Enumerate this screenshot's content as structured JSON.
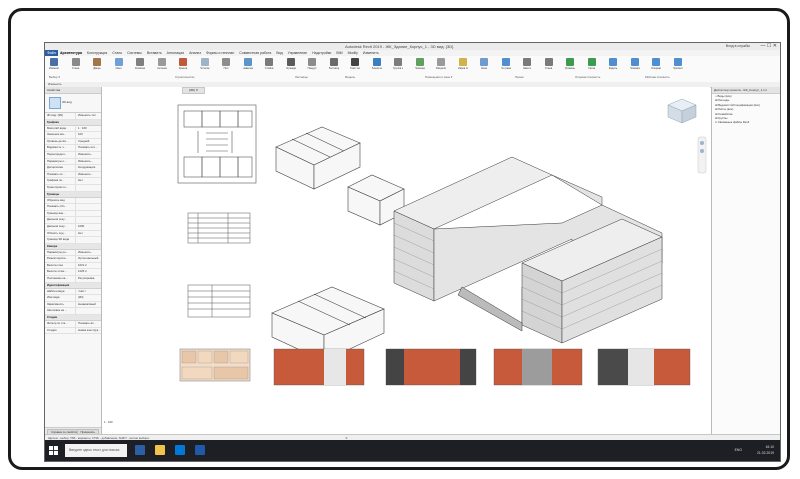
{
  "window": {
    "title": "Autodesk Revit 2019 - ЖК_Здание_Корпус_1 - 3D вид: {3D}",
    "search_hint": "Введите ключевое слово или фразу",
    "user": "Вход в службы",
    "controls": "—  ☐  ✕"
  },
  "menu": {
    "file": "Файл",
    "tabs": [
      "Архитектура",
      "Конструкция",
      "Сталь",
      "Системы",
      "Вставить",
      "Аннотации",
      "Анализ",
      "Формы и генплан",
      "Совместная работа",
      "Вид",
      "Управление",
      "Надстройки",
      "BIM",
      "Modify",
      "Изменить"
    ]
  },
  "ribbon": {
    "buttons": [
      {
        "label": "Изменить",
        "icon": "modify-arrow-icon",
        "color": "#4a6fa8"
      },
      {
        "label": "Стена",
        "icon": "wall-icon",
        "color": "#8a8a8a"
      },
      {
        "label": "Дверь",
        "icon": "door-icon",
        "color": "#a0764a"
      },
      {
        "label": "Окно",
        "icon": "window-icon",
        "color": "#6ea2d6"
      },
      {
        "label": "Компонент",
        "icon": "component-icon",
        "color": "#7f7f7f"
      },
      {
        "label": "Колонна",
        "icon": "column-icon",
        "color": "#9a9a9a"
      },
      {
        "label": "Крыша",
        "icon": "roof-icon",
        "color": "#c05a3c"
      },
      {
        "label": "Потолок",
        "icon": "ceiling-icon",
        "color": "#9fb4c8"
      },
      {
        "label": "Пол",
        "icon": "floor-icon",
        "color": "#8d8d8d"
      },
      {
        "label": "Навесная стена",
        "icon": "curtain-wall-icon",
        "color": "#5d95c8"
      },
      {
        "label": "Стойка",
        "icon": "mullion-icon",
        "color": "#7a7a7a"
      },
      {
        "label": "Ограждение",
        "icon": "railing-icon",
        "color": "#5b5b5b"
      },
      {
        "label": "Пандус",
        "icon": "ramp-icon",
        "color": "#8c8c8c"
      },
      {
        "label": "Лестница",
        "icon": "stair-icon",
        "color": "#6c6c6c"
      },
      {
        "label": "Текст модели",
        "icon": "model-text-icon",
        "color": "#444444"
      },
      {
        "label": "Линия модели",
        "icon": "model-line-icon",
        "color": "#3b7fbf"
      },
      {
        "label": "Группа модели",
        "icon": "model-group-icon",
        "color": "#7d7d7d"
      },
      {
        "label": "Помещение",
        "icon": "room-icon",
        "color": "#5fa05f"
      },
      {
        "label": "Разделитель",
        "icon": "separator-icon",
        "color": "#9a9a9a"
      },
      {
        "label": "Марка помещения",
        "icon": "room-tag-icon",
        "color": "#d2b348"
      },
      {
        "label": "Зона",
        "icon": "area-icon",
        "color": "#6f9bd0"
      },
      {
        "label": "По грани",
        "icon": "by-face-icon",
        "color": "#4f8fcf"
      },
      {
        "label": "Шахта",
        "icon": "shaft-icon",
        "color": "#7a7a7a"
      },
      {
        "label": "Стена",
        "icon": "opening-wall-icon",
        "color": "#7a7a7a"
      },
      {
        "label": "Уровень",
        "icon": "level-icon",
        "color": "#3c9b4f"
      },
      {
        "label": "Сетка",
        "icon": "grid-icon",
        "color": "#3c9b4f"
      },
      {
        "label": "Задать",
        "icon": "set-workplane-icon",
        "color": "#4f8fcf"
      },
      {
        "label": "Показать",
        "icon": "show-icon",
        "color": "#4f8fcf"
      },
      {
        "label": "Опорная плоскость",
        "icon": "ref-plane-icon",
        "color": "#4f8fcf"
      },
      {
        "label": "Просмотр",
        "icon": "viewer-icon",
        "color": "#4f8fcf"
      }
    ],
    "groups": [
      "Выбор ▾",
      "Строительство",
      "Лестницы",
      "Модель",
      "Помещения и зоны ▾",
      "Проем",
      "Опорная плоскость",
      "Рабочая плоскость"
    ]
  },
  "options_bar": "Изменить",
  "properties": {
    "title": "Свойства",
    "type_name": "3D вид",
    "selector": "3D вид: {3D}",
    "edit_type": "Изменить тип",
    "sections": [
      {
        "name": "Графика",
        "rows": [
          [
            "Масштаб вида",
            "1 : 100"
          ],
          [
            "Значение ма...",
            "100"
          ],
          [
            "Уровень детал...",
            "Средний"
          ],
          [
            "Видимость ч...",
            "Показать исх..."
          ],
          [
            "Переопредел...",
            "Изменить..."
          ],
          [
            "Параметры о...",
            "Изменить..."
          ],
          [
            "Дисциплина",
            "Координация"
          ],
          [
            "Показать ск...",
            "Изменить..."
          ],
          [
            "Графика по...",
            "Нет"
          ],
          [
            "Траектория со...",
            ""
          ]
        ]
      },
      {
        "name": "Границы",
        "rows": [
          [
            "Обрезать вид",
            ""
          ],
          [
            "Показать обл...",
            ""
          ],
          [
            "Граница анн...",
            ""
          ],
          [
            "Дальняя секу...",
            ""
          ],
          [
            "Дальняя секу...",
            "1600"
          ],
          [
            "Область под...",
            "Нет"
          ],
          [
            "Граница 3D вида",
            ""
          ]
        ]
      },
      {
        "name": "Камера",
        "rows": [
          [
            "Параметры ре...",
            "Изменить..."
          ],
          [
            "Режим перспе...",
            "Ортогональный"
          ],
          [
            "Высота глаз",
            "1621.2"
          ],
          [
            "Высота точки ...",
            "1225.4"
          ],
          [
            "Положение кa...",
            "Регулировка"
          ]
        ]
      },
      {
        "name": "Идентификация",
        "rows": [
          [
            "Шаблон вида",
            "<Нет>"
          ],
          [
            "Имя вида",
            "{3D}"
          ],
          [
            "Зависимость",
            "Независимый"
          ],
          [
            "Заголовок на ...",
            ""
          ]
        ]
      },
      {
        "name": "Стадии",
        "rows": [
          [
            "Фильтр по ста...",
            "Показать вс..."
          ],
          [
            "Стадия",
            "Новая конструк..."
          ]
        ]
      }
    ],
    "help_link": "Справка по свойствам",
    "apply": "Применить"
  },
  "view": {
    "tab": "{3D}",
    "scale": "1 : 100"
  },
  "browser": {
    "title": "Диспетчер проекта - ЖК_Корпус_1.rvt",
    "items": [
      "□ Виды (все)",
      "⊞ Легенды",
      "⊞ Ведомости/Спецификации (все)",
      "⊞ Листы (все)",
      "⊞ Семейства",
      "⊞ Группы",
      "∞ Связанные файлы Revit"
    ]
  },
  "status": {
    "hint": "Щелчок - выбор; TAB - варианты; CTRL - добавление; SHIFT - снятие выбора.",
    "model": ":0"
  },
  "taskbar": {
    "search": "Введите здесь текст для поиска",
    "lang": "ENG",
    "time": "16:10",
    "date": "21.02.2019"
  }
}
